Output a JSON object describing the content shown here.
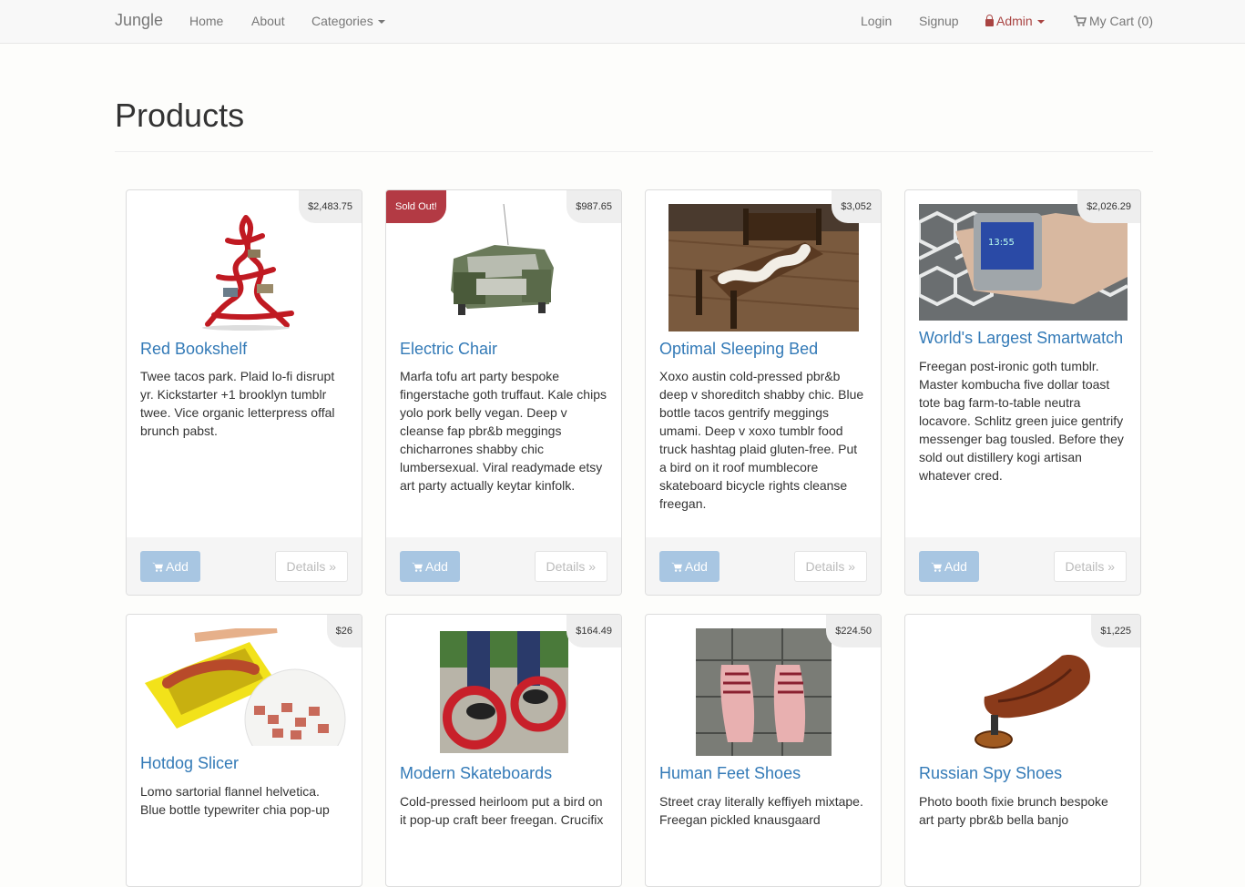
{
  "navbar": {
    "brand": "Jungle",
    "links": {
      "home": "Home",
      "about": "About",
      "categories": "Categories"
    },
    "right": {
      "login": "Login",
      "signup": "Signup",
      "admin": "Admin",
      "cart": "My Cart (0)"
    },
    "admin_icon": "lock-icon",
    "cart_icon": "shopping-cart-icon"
  },
  "page": {
    "title": "Products"
  },
  "buttons": {
    "add": "Add",
    "details": "Details »"
  },
  "colors": {
    "link": "#337ab7",
    "sold": "#b33a44",
    "admin": "#a94442",
    "add_button": "#a8c6e2"
  },
  "products": [
    {
      "name": "Red Bookshelf",
      "price": "$2,483.75",
      "sold_out": false,
      "description": "Twee tacos park. Plaid lo-fi disrupt yr. Kickstarter +1 brooklyn tumblr twee. Vice organic letterpress offal brunch pabst."
    },
    {
      "name": "Electric Chair",
      "price": "$987.65",
      "sold_out": true,
      "sold_label": "Sold Out!",
      "description": "Marfa tofu art party bespoke fingerstache goth truffaut. Kale chips yolo pork belly vegan. Deep v cleanse fap pbr&b meggings chicharrones shabby chic lumbersexual. Viral readymade etsy art party actually keytar kinfolk."
    },
    {
      "name": "Optimal Sleeping Bed",
      "price": "$3,052",
      "sold_out": false,
      "description": "Xoxo austin cold-pressed pbr&b deep v shoreditch shabby chic. Blue bottle tacos gentrify meggings umami. Deep v xoxo tumblr food truck hashtag plaid gluten-free. Put a bird on it roof mumblecore skateboard bicycle rights cleanse freegan."
    },
    {
      "name": "World's Largest Smartwatch",
      "price": "$2,026.29",
      "sold_out": false,
      "description": "Freegan post-ironic goth tumblr. Master kombucha five dollar toast tote bag farm-to-table neutra locavore. Schlitz green juice gentrify messenger bag tousled. Before they sold out distillery kogi artisan whatever cred."
    },
    {
      "name": "Hotdog Slicer",
      "price": "$26",
      "sold_out": false,
      "description": "Lomo sartorial flannel helvetica. Blue bottle typewriter chia pop-up"
    },
    {
      "name": "Modern Skateboards",
      "price": "$164.49",
      "sold_out": false,
      "description": "Cold-pressed heirloom put a bird on it pop-up craft beer freegan. Crucifix"
    },
    {
      "name": "Human Feet Shoes",
      "price": "$224.50",
      "sold_out": false,
      "description": "Street cray literally keffiyeh mixtape. Freegan pickled knausgaard"
    },
    {
      "name": "Russian Spy Shoes",
      "price": "$1,225",
      "sold_out": false,
      "description": "Photo booth fixie brunch bespoke art party pbr&b bella banjo"
    }
  ]
}
